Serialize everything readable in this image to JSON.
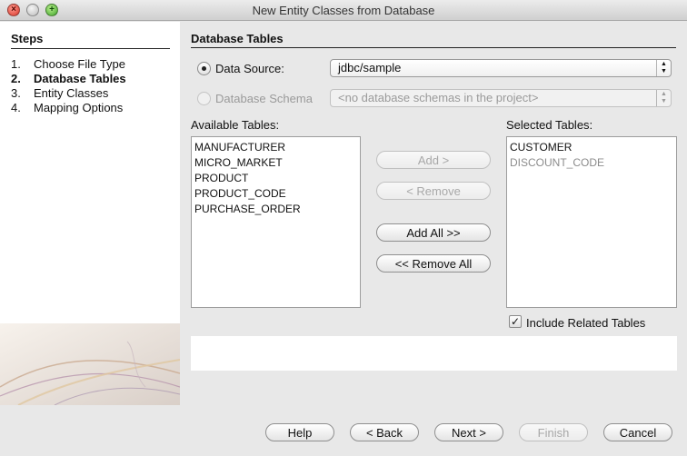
{
  "window": {
    "title": "New Entity Classes from Database"
  },
  "steps": {
    "title": "Steps",
    "items": [
      {
        "num": "1.",
        "label": "Choose File Type",
        "current": false
      },
      {
        "num": "2.",
        "label": "Database Tables",
        "current": true
      },
      {
        "num": "3.",
        "label": "Entity Classes",
        "current": false
      },
      {
        "num": "4.",
        "label": "Mapping Options",
        "current": false
      }
    ]
  },
  "panel": {
    "title": "Database Tables",
    "data_source": {
      "label": "Data Source:",
      "value": "jdbc/sample",
      "selected": true
    },
    "database_schema": {
      "label": "Database Schema",
      "value": "<no database schemas in the project>",
      "selected": false,
      "enabled": false
    },
    "available": {
      "label": "Available Tables:",
      "items": [
        "MANUFACTURER",
        "MICRO_MARKET",
        "PRODUCT",
        "PRODUCT_CODE",
        "PURCHASE_ORDER"
      ]
    },
    "selected_tables": {
      "label": "Selected Tables:",
      "items": [
        {
          "name": "CUSTOMER",
          "enabled": true
        },
        {
          "name": "DISCOUNT_CODE",
          "enabled": false
        }
      ]
    },
    "buttons": {
      "add": "Add >",
      "remove": "< Remove",
      "add_all": "Add All >>",
      "remove_all": "<< Remove All"
    },
    "include_related": {
      "label": "Include Related Tables",
      "checked": true
    }
  },
  "footer": {
    "help": "Help",
    "back": "< Back",
    "next": "Next >",
    "finish": "Finish",
    "cancel": "Cancel"
  },
  "icons": {
    "close": "close-icon",
    "minimize": "minimize-icon",
    "zoom": "zoom-icon",
    "checkmark": "checkmark-icon"
  },
  "colors": {
    "window_bg": "#e8e8e8",
    "sidebar_bg": "#ffffff",
    "disabled_text": "#9a9a9a"
  }
}
